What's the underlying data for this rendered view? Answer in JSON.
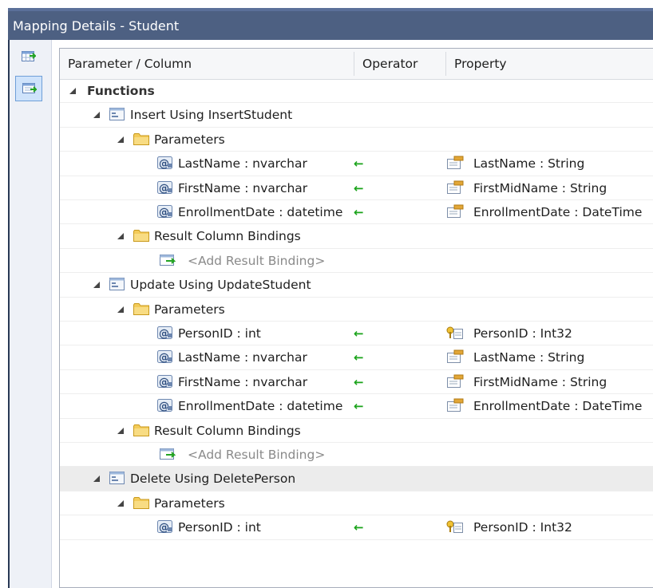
{
  "window": {
    "title": "Mapping Details - Student"
  },
  "columns": {
    "param": "Parameter / Column",
    "operator": "Operator",
    "property": "Property"
  },
  "add_binding": "<Add Result Binding>",
  "arrow": "←",
  "icons": [
    "table-icon",
    "function-icon",
    "folder-icon",
    "parameter-icon",
    "property-icon",
    "key-property-icon",
    "add-binding-icon",
    "expand-triangle-icon",
    "arrow-left-icon"
  ],
  "colors": {
    "titlebar": "#4d6082",
    "frame": "#293955",
    "arrow": "#1aa31a",
    "selected_row": "#ececec",
    "folder": "#f3cb59"
  },
  "rows": [
    {
      "type": "root",
      "label": "Functions"
    },
    {
      "type": "function",
      "label": "Insert Using InsertStudent"
    },
    {
      "type": "folder",
      "label": "Parameters"
    },
    {
      "type": "param",
      "label": "LastName : nvarchar",
      "property": "LastName : String"
    },
    {
      "type": "param",
      "label": "FirstName : nvarchar",
      "property": "FirstMidName : String"
    },
    {
      "type": "param",
      "label": "EnrollmentDate : datetime",
      "property": "EnrollmentDate : DateTime"
    },
    {
      "type": "folder",
      "label": "Result Column Bindings"
    },
    {
      "type": "add"
    },
    {
      "type": "function",
      "label": "Update Using UpdateStudent"
    },
    {
      "type": "folder",
      "label": "Parameters"
    },
    {
      "type": "param",
      "label": "PersonID : int",
      "property": "PersonID : Int32",
      "key": true
    },
    {
      "type": "param",
      "label": "LastName : nvarchar",
      "property": "LastName : String"
    },
    {
      "type": "param",
      "label": "FirstName : nvarchar",
      "property": "FirstMidName : String"
    },
    {
      "type": "param",
      "label": "EnrollmentDate : datetime",
      "property": "EnrollmentDate : DateTime"
    },
    {
      "type": "folder",
      "label": "Result Column Bindings"
    },
    {
      "type": "add"
    },
    {
      "type": "function",
      "label": "Delete Using DeletePerson",
      "selected": true
    },
    {
      "type": "folder",
      "label": "Parameters"
    },
    {
      "type": "param",
      "label": "PersonID : int",
      "property": "PersonID : Int32",
      "key": true
    }
  ]
}
